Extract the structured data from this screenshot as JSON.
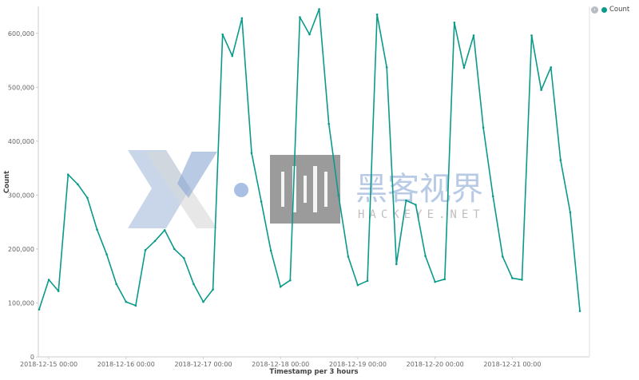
{
  "colors": {
    "series": "#0a9a8a",
    "axis": "#cccccc",
    "legend_toggle": "#b8bcc2"
  },
  "legend": {
    "toggle_icon": "chevron-right-icon",
    "items": [
      {
        "label": "Count",
        "color": "#0a9a8a"
      }
    ]
  },
  "watermark": {
    "title": "黑客视界",
    "subtitle": "HACKEYE.NET"
  },
  "chart_data": {
    "type": "line",
    "xlabel": "Timestamp per 3 hours",
    "ylabel": "Count",
    "ylim": [
      0,
      650000
    ],
    "yticks": [
      0,
      100000,
      200000,
      300000,
      400000,
      500000,
      600000
    ],
    "ytick_labels": [
      "0",
      "100,000",
      "200,000",
      "300,000",
      "400,000",
      "500,000",
      "600,000"
    ],
    "xticks": [
      "2018-12-15 00:00",
      "2018-12-16 00:00",
      "2018-12-17 00:00",
      "2018-12-18 00:00",
      "2018-12-19 00:00",
      "2018-12-20 00:00",
      "2018-12-21 00:00"
    ],
    "x_interval": "3 hours",
    "x_start": "2018-12-14 21:00",
    "legend_position": "top-right",
    "grid": false,
    "series": [
      {
        "name": "Count",
        "color": "#0a9a8a",
        "values": [
          88000,
          143000,
          122000,
          338000,
          320000,
          295000,
          236000,
          190000,
          135000,
          102000,
          95000,
          198000,
          215000,
          235000,
          200000,
          183000,
          135000,
          102000,
          125000,
          598000,
          558000,
          628000,
          378000,
          288000,
          197000,
          130000,
          142000,
          630000,
          598000,
          645000,
          432000,
          300000,
          186000,
          133000,
          141000,
          635000,
          537000,
          172000,
          290000,
          282000,
          187000,
          139000,
          144000,
          620000,
          536000,
          596000,
          425000,
          298000,
          186000,
          146000,
          143000,
          596000,
          495000,
          537000,
          365000,
          268000,
          85000
        ]
      }
    ]
  }
}
